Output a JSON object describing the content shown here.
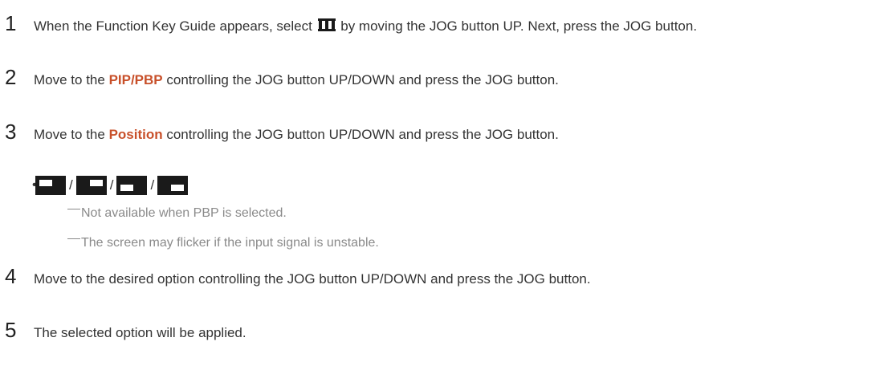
{
  "steps": [
    {
      "num": "1",
      "pre": "When the Function Key Guide appears, select ",
      "icon": "menu-icon",
      "post": " by moving the JOG button UP. Next, press the JOG button."
    },
    {
      "num": "2",
      "pre": "Move to the ",
      "highlight": "PIP/PBP",
      "post": " controlling the JOG button UP/DOWN and press the JOG button."
    },
    {
      "num": "3",
      "pre": "Move to the ",
      "highlight": "Position",
      "post": " controlling the JOG button UP/DOWN and press the JOG button."
    },
    {
      "num": "4",
      "text": "Move to the desired option controlling the JOG button UP/DOWN and press the JOG button."
    },
    {
      "num": "5",
      "text": "The selected option will be applied."
    }
  ],
  "position_options": {
    "bullet": "•",
    "separator": "/",
    "icons": [
      "pip-top-left-icon",
      "pip-top-right-icon",
      "pip-bottom-left-icon",
      "pip-bottom-right-icon"
    ]
  },
  "notes": [
    "Not available when PBP is selected.",
    "The screen may flicker if the input signal is unstable."
  ],
  "colors": {
    "highlight": "#c8502a",
    "note_text": "#8a8a8a"
  }
}
